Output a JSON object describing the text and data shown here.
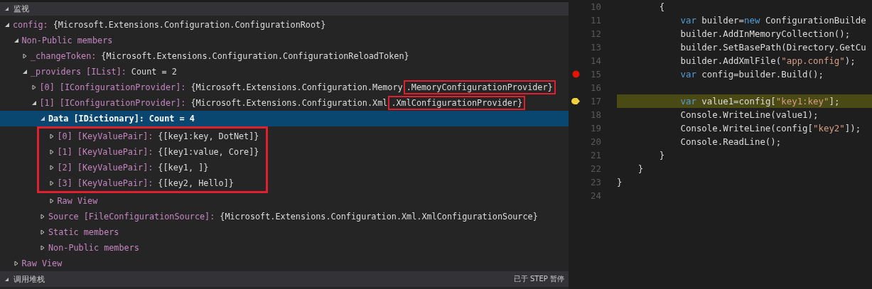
{
  "watch": {
    "title": "监视",
    "expanded": true,
    "nodes": [
      {
        "name": "config:",
        "value": "{Microsoft.Extensions.Configuration.ConfigurationRoot}",
        "expanded": true,
        "selected": false,
        "children": [
          {
            "name": "Non-Public members",
            "expanded": true,
            "selected": false,
            "children": [
              {
                "name": "_changeToken:",
                "value": "{Microsoft.Extensions.Configuration.ConfigurationReloadToken}",
                "expanded": false,
                "selected": false
              },
              {
                "name": "_providers",
                "type": "[IList]:",
                "value": "Count = 2",
                "expanded": true,
                "selected": false,
                "children": [
                  {
                    "name": "[0]",
                    "type": "[IConfigurationProvider]:",
                    "value": "{Microsoft.Extensions.Configuration.Memory",
                    "value_boxed": ".MemoryConfigurationProvider}",
                    "expanded": false,
                    "selected": false
                  },
                  {
                    "name": "[1]",
                    "type": "[IConfigurationProvider]:",
                    "value": "{Microsoft.Extensions.Configuration.Xml",
                    "value_boxed": ".XmlConfigurationProvider}",
                    "expanded": true,
                    "selected": false,
                    "children": [
                      {
                        "name": "Data",
                        "type": "[IDictionary]:",
                        "value": "Count = 4",
                        "expanded": true,
                        "selected": true,
                        "children": [
                          {
                            "name": "[0]",
                            "type": "[KeyValuePair]:",
                            "value": "{[key1:key, DotNet]}",
                            "expanded": false,
                            "selected": false,
                            "boxed": true
                          },
                          {
                            "name": "[1]",
                            "type": "[KeyValuePair]:",
                            "value": "{[key1:value, Core]}",
                            "expanded": false,
                            "selected": false,
                            "boxed": true
                          },
                          {
                            "name": "[2]",
                            "type": "[KeyValuePair]:",
                            "value": "{[key1, ]}",
                            "expanded": false,
                            "selected": false,
                            "boxed": true
                          },
                          {
                            "name": "[3]",
                            "type": "[KeyValuePair]:",
                            "value": "{[key2, Hello]}",
                            "expanded": false,
                            "selected": false,
                            "boxed": true
                          },
                          {
                            "name": "Raw View",
                            "expanded": false,
                            "selected": false,
                            "boxed": false
                          }
                        ]
                      },
                      {
                        "name": "Source",
                        "type": "[FileConfigurationSource]:",
                        "value": "{Microsoft.Extensions.Configuration.Xml.XmlConfigurationSource}",
                        "expanded": false,
                        "selected": false
                      },
                      {
                        "name": "Static members",
                        "expanded": false,
                        "selected": false
                      },
                      {
                        "name": "Non-Public members",
                        "expanded": false,
                        "selected": false
                      }
                    ]
                  }
                ]
              }
            ]
          },
          {
            "name": "Raw View",
            "expanded": false,
            "selected": false
          }
        ]
      }
    ]
  },
  "call_stack": {
    "title": "调用堆栈",
    "expanded": true,
    "status": "已于 STEP 暂停"
  },
  "editor": {
    "lines": [
      {
        "number": "10",
        "breakpoint": false,
        "current": false,
        "tokens": [
          {
            "text": "        {",
            "kind": "plain"
          }
        ]
      },
      {
        "number": "11",
        "breakpoint": false,
        "current": false,
        "tokens": [
          {
            "text": "            var",
            "kind": "keyword"
          },
          {
            "text": " builder=",
            "kind": "plain"
          },
          {
            "text": "new",
            "kind": "keyword"
          },
          {
            "text": " ConfigurationBuilde",
            "kind": "plain"
          }
        ]
      },
      {
        "number": "12",
        "breakpoint": false,
        "current": false,
        "tokens": [
          {
            "text": "            builder.AddInMemoryCollection();",
            "kind": "plain"
          }
        ]
      },
      {
        "number": "13",
        "breakpoint": false,
        "current": false,
        "tokens": [
          {
            "text": "            builder.SetBasePath(Directory.GetCu",
            "kind": "plain"
          }
        ]
      },
      {
        "number": "14",
        "breakpoint": false,
        "current": false,
        "tokens": [
          {
            "text": "            builder.AddXmlFile(",
            "kind": "plain"
          },
          {
            "text": "\"app.config\"",
            "kind": "string"
          },
          {
            "text": ");",
            "kind": "plain"
          }
        ]
      },
      {
        "number": "15",
        "breakpoint": true,
        "current": false,
        "tokens": [
          {
            "text": "            var",
            "kind": "keyword"
          },
          {
            "text": " config=builder.Build();",
            "kind": "plain"
          }
        ]
      },
      {
        "number": "16",
        "breakpoint": false,
        "current": false
      },
      {
        "number": "17",
        "breakpoint": false,
        "current": true,
        "tokens": [
          {
            "text": "            var",
            "kind": "keyword"
          },
          {
            "text": " value1=config[",
            "kind": "plain"
          },
          {
            "text": "\"key1:key\"",
            "kind": "string"
          },
          {
            "text": "];",
            "kind": "plain"
          }
        ]
      },
      {
        "number": "18",
        "breakpoint": false,
        "current": false,
        "tokens": [
          {
            "text": "            Console.WriteLine(value1);",
            "kind": "plain"
          }
        ]
      },
      {
        "number": "19",
        "breakpoint": false,
        "current": false,
        "tokens": [
          {
            "text": "            Console.WriteLine(config[",
            "kind": "plain"
          },
          {
            "text": "\"key2\"",
            "kind": "string"
          },
          {
            "text": "]);",
            "kind": "plain"
          }
        ]
      },
      {
        "number": "20",
        "breakpoint": false,
        "current": false,
        "tokens": [
          {
            "text": "            Console.ReadLine();",
            "kind": "plain"
          }
        ]
      },
      {
        "number": "21",
        "breakpoint": false,
        "current": false,
        "tokens": [
          {
            "text": "        }",
            "kind": "plain"
          }
        ]
      },
      {
        "number": "22",
        "breakpoint": false,
        "current": false,
        "tokens": [
          {
            "text": "    }",
            "kind": "plain"
          }
        ]
      },
      {
        "number": "23",
        "breakpoint": false,
        "current": false,
        "tokens": [
          {
            "text": "}",
            "kind": "plain"
          }
        ]
      },
      {
        "number": "24",
        "breakpoint": false,
        "current": false
      }
    ]
  }
}
